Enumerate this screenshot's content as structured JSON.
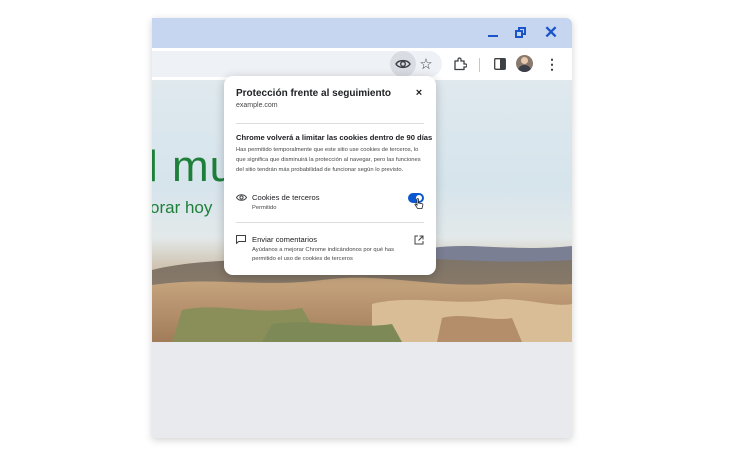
{
  "window": {
    "controls": {
      "minimize_icon": "minimize-icon",
      "maximize_icon": "restore-icon",
      "close_icon": "close-icon",
      "close_glyph": "✕"
    },
    "accent_color": "#1a56c9",
    "titlebar_color": "#c7d6f0"
  },
  "toolbar": {
    "icons": [
      "eye-icon",
      "star-icon",
      "extension-icon",
      "side-panel-icon",
      "avatar",
      "more-menu-icon"
    ],
    "star_glyph": "☆",
    "kebab_glyph": "⋮"
  },
  "page": {
    "headline": "l mu",
    "subline": "orar hoy",
    "brand_color": "#1e7f3a"
  },
  "popup": {
    "title": "Protección frente al seguimiento",
    "site": "example.com",
    "close_glyph": "×",
    "heading": "Chrome volverá a limitar las cookies dentro de 90 días",
    "body": "Has permitido temporalmente que este sitio use cookies de terceros, lo que significa que disminuirá la protección al navegar, pero las funciones del sitio tendrán más probabilidad de funcionar según lo previsto.",
    "cookie_row": {
      "label": "Cookies de terceros",
      "status": "Permitido",
      "toggle_on": true
    },
    "feedback": {
      "label": "Enviar comentarios",
      "description": "Ayúdanos a mejorar Chrome indicándonos por qué has permitido el uso de cookies de terceros"
    },
    "toggle_color": "#0b57d0"
  }
}
